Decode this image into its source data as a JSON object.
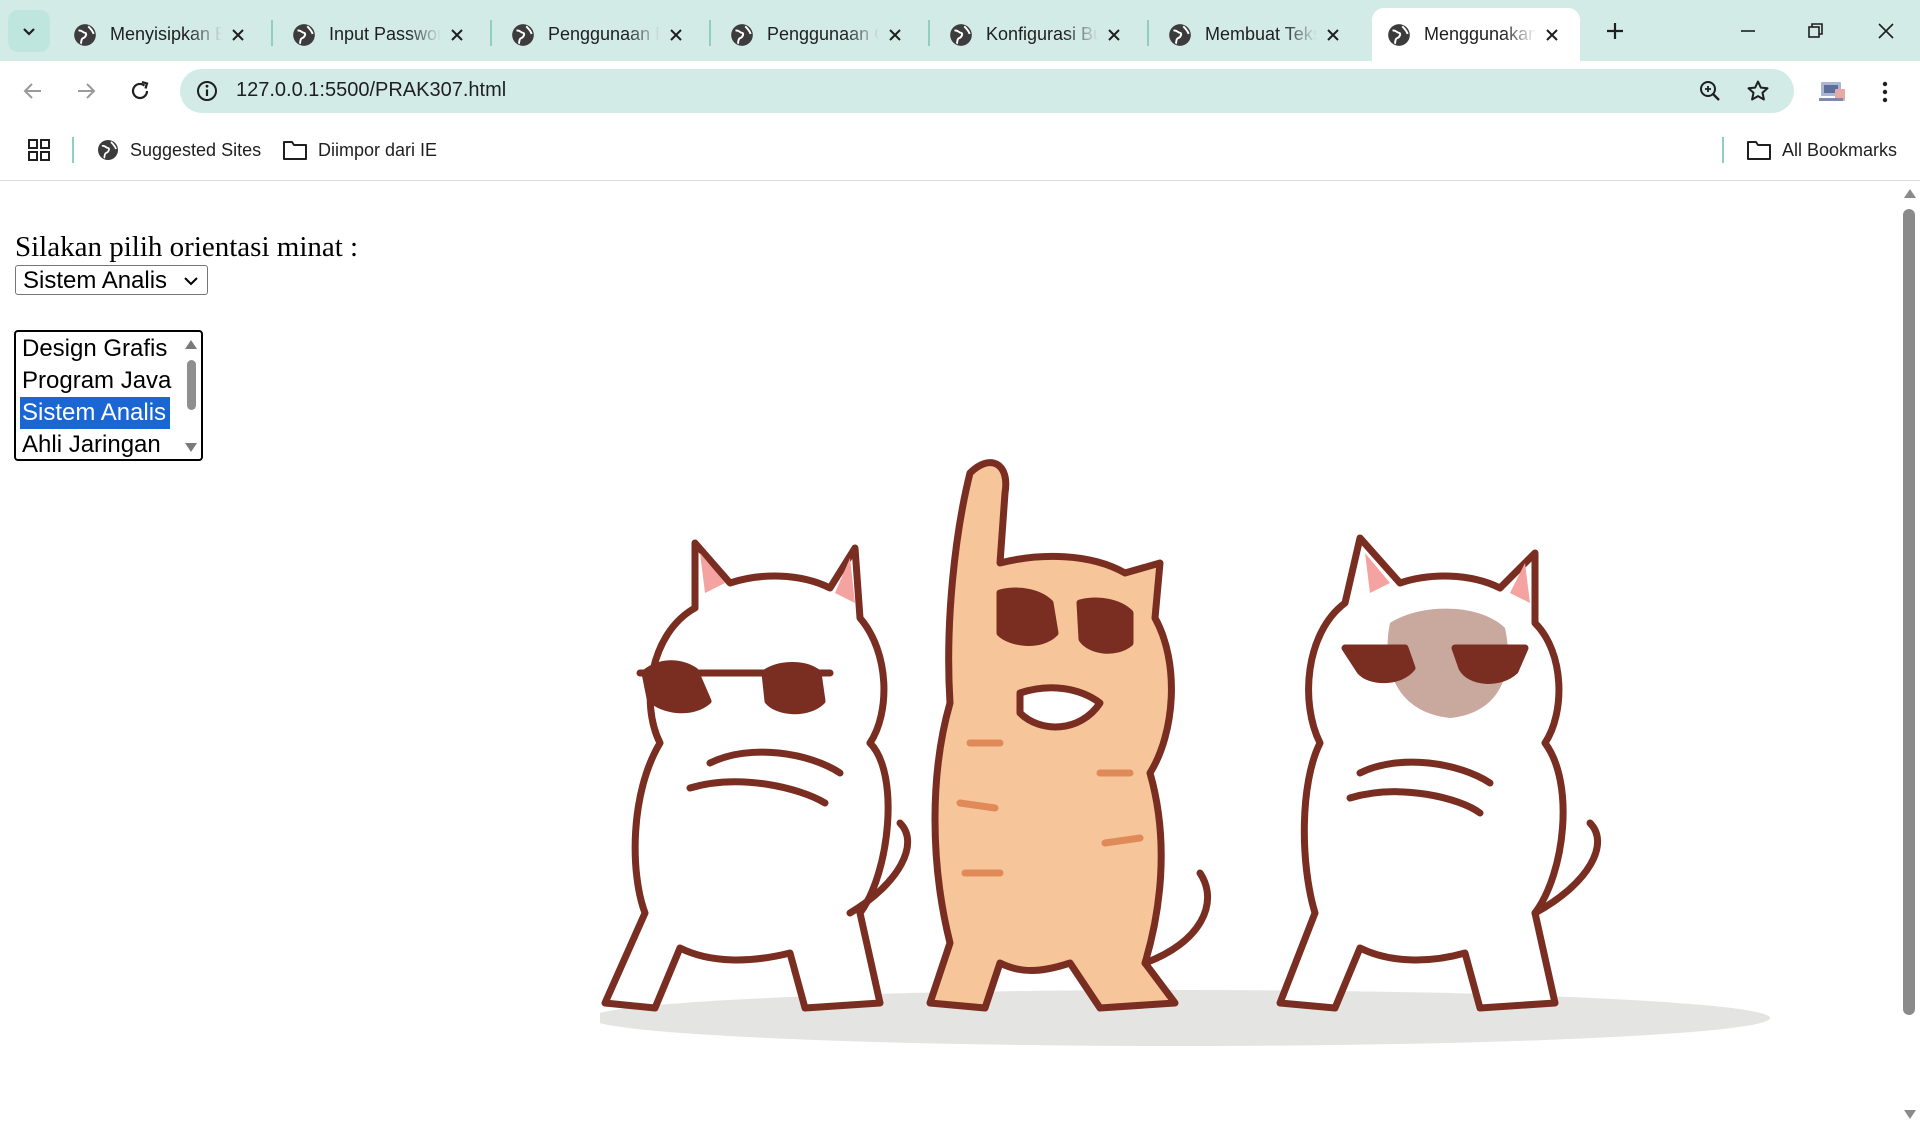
{
  "tabs": [
    {
      "title": "Menyisipkan Emoji",
      "active": false
    },
    {
      "title": "Input Password",
      "active": false
    },
    {
      "title": "Penggunaan Radio",
      "active": false
    },
    {
      "title": "Penggunaan Checkbox",
      "active": false
    },
    {
      "title": "Konfigurasi Button",
      "active": false
    },
    {
      "title": "Membuat Teks Area",
      "active": false
    },
    {
      "title": "Menggunakan Select",
      "active": true
    }
  ],
  "address_bar": {
    "url": "127.0.0.1:5500/PRAK307.html"
  },
  "bookmarks": {
    "items": [
      {
        "label": "Suggested Sites",
        "icon": "globe-icon"
      },
      {
        "label": "Diimpor dari IE",
        "icon": "folder-icon"
      }
    ],
    "all_bookmarks": "All Bookmarks"
  },
  "page": {
    "prompt": "Silakan pilih orientasi minat :",
    "dropdown": {
      "selected": "Sistem Analis"
    },
    "listbox": {
      "options": [
        "Design Grafis",
        "Program Java",
        "Sistem Analis",
        "Ahli Jaringan"
      ],
      "selected": "Sistem Analis"
    },
    "illustration": "three-dancing-cats-with-sunglasses"
  },
  "colors": {
    "chrome_bg": "#d3ebe6",
    "accent": "#8fcfc2",
    "selection": "#1a66d2"
  }
}
